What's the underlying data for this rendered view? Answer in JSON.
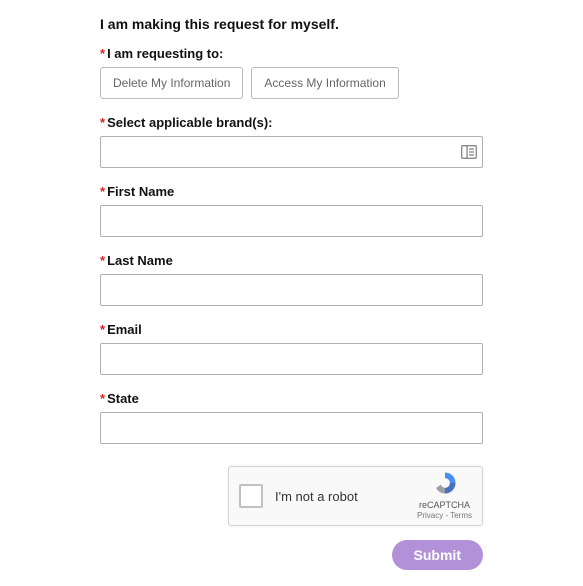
{
  "heading": "I am making this request for myself.",
  "request_label": "I am requesting to:",
  "options": {
    "delete": "Delete My Information",
    "access": "Access My Information"
  },
  "brand_label": "Select applicable brand(s):",
  "first_name_label": "First Name",
  "last_name_label": "Last Name",
  "email_label": "Email",
  "state_label": "State",
  "captcha": {
    "label": "I'm not a robot",
    "brand": "reCAPTCHA",
    "terms": "Privacy - Terms"
  },
  "submit_label": "Submit",
  "required_mark": "*"
}
